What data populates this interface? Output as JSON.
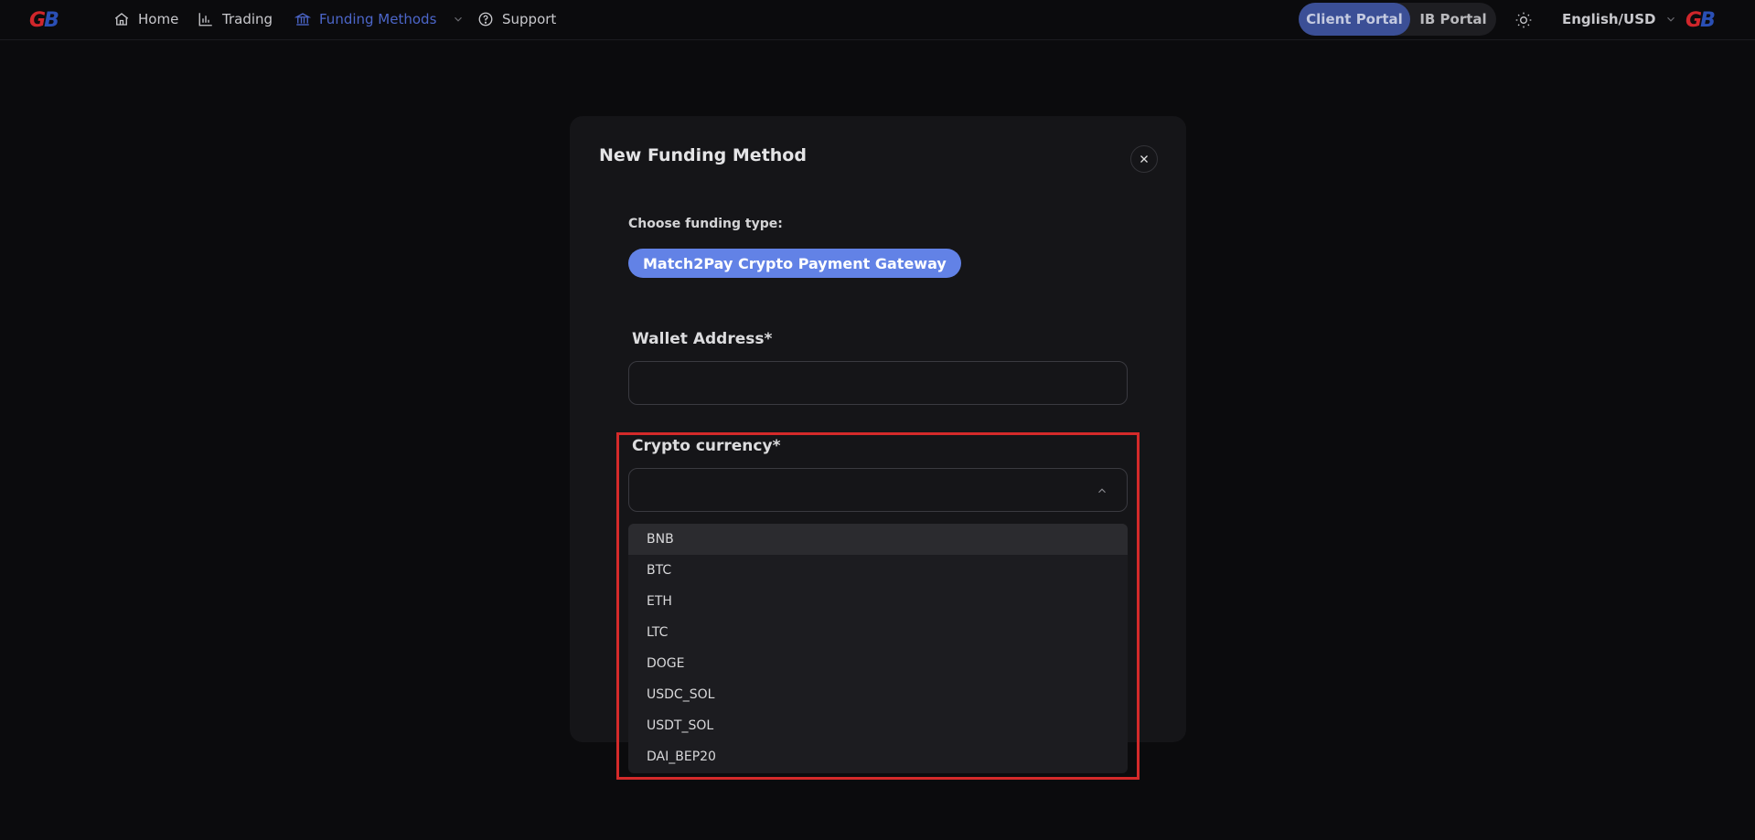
{
  "nav": {
    "logo_text_g": "G",
    "logo_text_b": "B",
    "items": [
      {
        "label": "Home",
        "icon": "home-icon"
      },
      {
        "label": "Trading",
        "icon": "chart-icon"
      },
      {
        "label": "Funding Methods",
        "icon": "bank-icon",
        "active": true
      },
      {
        "label": "Support",
        "icon": "help-icon"
      }
    ],
    "client_portal": "Client Portal",
    "ib_portal": "IB Portal",
    "language": "English/USD"
  },
  "modal": {
    "title": "New Funding Method",
    "funding_type_label": "Choose funding type:",
    "funding_type_value": "Match2Pay Crypto Payment Gateway",
    "wallet_label": "Wallet Address*",
    "wallet_value": "",
    "crypto_label": "Crypto currency*",
    "crypto_value": "",
    "crypto_options": [
      "BNB",
      "BTC",
      "ETH",
      "LTC",
      "DOGE",
      "USDC_SOL",
      "USDT_SOL",
      "DAI_BEP20"
    ]
  },
  "colors": {
    "accent": "#6282e6",
    "active_nav": "#4c66c9",
    "highlight": "#d42a2a",
    "brand_red": "#d0262b",
    "brand_blue": "#2a4fb5"
  }
}
